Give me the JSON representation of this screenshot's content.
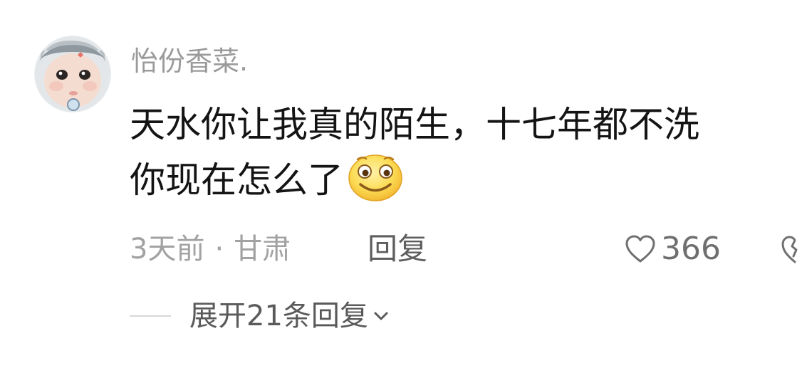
{
  "comment": {
    "username": "怡份香菜.",
    "text_line1": "天水你让我真的陌生，十七年都不洗",
    "text_line2": "你现在怎么了",
    "emoji": "smile-emoji",
    "time": "3天前",
    "separator": "·",
    "location": "甘肃",
    "reply_label": "回复",
    "like_count": "366",
    "expand_label": "展开21条回复"
  },
  "colors": {
    "username": "#9a9a9a",
    "content": "#141414",
    "meta": "#a2a2a2",
    "reply": "#5e5e5e",
    "emoji_face": "#f9d44a"
  }
}
